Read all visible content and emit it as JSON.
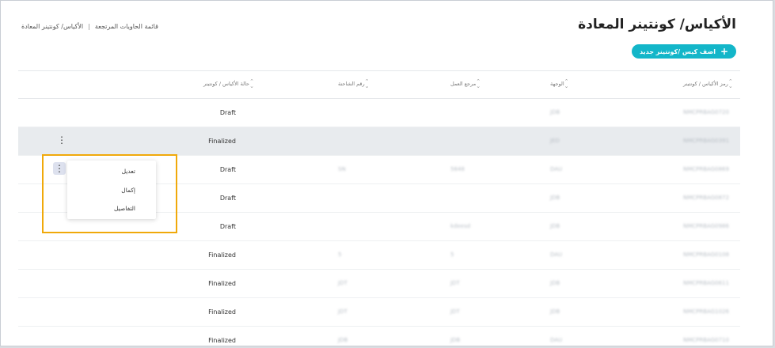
{
  "header": {
    "title": "الأكياس/ كونتينر المعادة",
    "breadcrumb": [
      "قائمة الحاويات المرتجعة",
      "الأكياس/ كونتينر المعادة"
    ],
    "breadcrumb_sep": "|",
    "add_button_label": "اضف كيس /كونتينر جديد"
  },
  "table": {
    "columns": [
      "رمز الأكياس / كونتينر",
      "الوجهة",
      "مرجع العمل",
      "رقم الشاحنة",
      "حالة الأكياس / كونتينر"
    ],
    "rows": [
      {
        "code": "NMCPRBAG0720",
        "dest": "JDB",
        "ref": "",
        "num": "",
        "status": "Draft"
      },
      {
        "code": "NMCPRBAG0391",
        "dest": "JED",
        "ref": "",
        "num": "",
        "status": "Finalized"
      },
      {
        "code": "NMCPRBAG0869",
        "dest": "DAU",
        "ref": "5648",
        "num": "SN",
        "status": "Draft"
      },
      {
        "code": "NMCPRBAG0872",
        "dest": "JDB",
        "ref": "",
        "num": "",
        "status": "Draft"
      },
      {
        "code": "NMCPRBAG0986",
        "dest": "JDB",
        "ref": "kdeesd",
        "num": "",
        "status": "Draft"
      },
      {
        "code": "NMCPRBAG0108",
        "dest": "DAU",
        "ref": "5",
        "num": "5",
        "status": "Finalized"
      },
      {
        "code": "NMCPRBAG0611",
        "dest": "JDB",
        "ref": "JDT",
        "num": "JDT",
        "status": "Finalized"
      },
      {
        "code": "NMCPRBAG1026",
        "dest": "JDB",
        "ref": "JDT",
        "num": "JDT",
        "status": "Finalized"
      },
      {
        "code": "NMCPRBAG0710",
        "dest": "DAU",
        "ref": "JDB",
        "num": "JDB",
        "status": "Finalized"
      }
    ]
  },
  "context_menu": {
    "items": [
      "تعديل",
      "إكمال",
      "التفاصيل"
    ]
  },
  "colors": {
    "accent": "#13b6c9",
    "highlight": "#f0a90a"
  }
}
